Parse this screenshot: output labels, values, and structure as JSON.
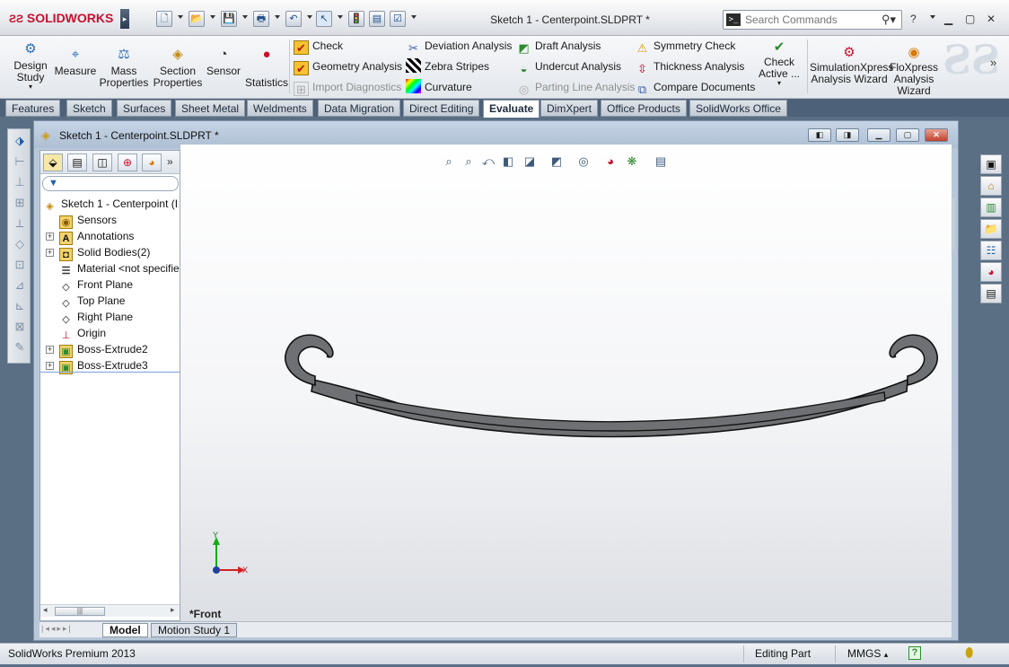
{
  "app": {
    "brand": "SOLIDWORKS",
    "title": "Sketch 1 - Centerpoint.SLDPRT *",
    "search_placeholder": "Search Commands"
  },
  "toolbar_big": [
    {
      "label": "Design\nStudy",
      "icon": "design-study-icon"
    },
    {
      "label": "Measure",
      "icon": "measure-icon"
    },
    {
      "label": "Mass\nProperties",
      "icon": "mass-properties-icon"
    },
    {
      "label": "Section\nProperties",
      "icon": "section-properties-icon"
    },
    {
      "label": "Sensor",
      "icon": "sensor-icon"
    },
    {
      "label": "Statistics",
      "icon": "statistics-icon"
    }
  ],
  "toolbar_small": {
    "check": "Check",
    "geometry_analysis": "Geometry Analysis",
    "import_diagnostics": "Import Diagnostics",
    "deviation_analysis": "Deviation Analysis",
    "zebra_stripes": "Zebra Stripes",
    "curvature": "Curvature",
    "draft_analysis": "Draft Analysis",
    "undercut_analysis": "Undercut Analysis",
    "parting_line_analysis": "Parting Line Analysis",
    "symmetry_check": "Symmetry Check",
    "thickness_analysis": "Thickness Analysis",
    "compare_documents": "Compare Documents",
    "check_active": "Check\nActive ...",
    "simulationxpress": "SimulationXpress\nAnalysis Wizard",
    "floxpress": "FloXpress\nAnalysis\nWizard"
  },
  "tabs": [
    "Features",
    "Sketch",
    "Surfaces",
    "Sheet Metal",
    "Weldments",
    "Data Migration",
    "Direct Editing",
    "Evaluate",
    "DimXpert",
    "Office Products",
    "SolidWorks Office"
  ],
  "active_tab": "Evaluate",
  "doc_window": {
    "title": "Sketch 1 - Centerpoint.SLDPRT *"
  },
  "tree": [
    {
      "label": "Sketch 1 - Centerpoint  (I",
      "icon": "part-icon",
      "expandable": false
    },
    {
      "label": "Sensors",
      "icon": "sensors-icon",
      "expandable": false
    },
    {
      "label": "Annotations",
      "icon": "annotations-icon",
      "expandable": true
    },
    {
      "label": "Solid Bodies(2)",
      "icon": "solid-bodies-icon",
      "expandable": true
    },
    {
      "label": "Material <not specifie",
      "icon": "material-icon",
      "expandable": false
    },
    {
      "label": "Front Plane",
      "icon": "plane-icon",
      "expandable": false
    },
    {
      "label": "Top Plane",
      "icon": "plane-icon",
      "expandable": false
    },
    {
      "label": "Right Plane",
      "icon": "plane-icon",
      "expandable": false
    },
    {
      "label": "Origin",
      "icon": "origin-icon",
      "expandable": false
    },
    {
      "label": "Boss-Extrude2",
      "icon": "extrude-icon",
      "expandable": true
    },
    {
      "label": "Boss-Extrude3",
      "icon": "extrude-icon",
      "expandable": true
    }
  ],
  "view_label": "*Front",
  "triad": {
    "y": "Y",
    "x": "X"
  },
  "bottom_tabs": [
    "Model",
    "Motion Study 1"
  ],
  "status": {
    "product": "SolidWorks Premium 2013",
    "mode": "Editing Part",
    "units": "MMGS"
  }
}
